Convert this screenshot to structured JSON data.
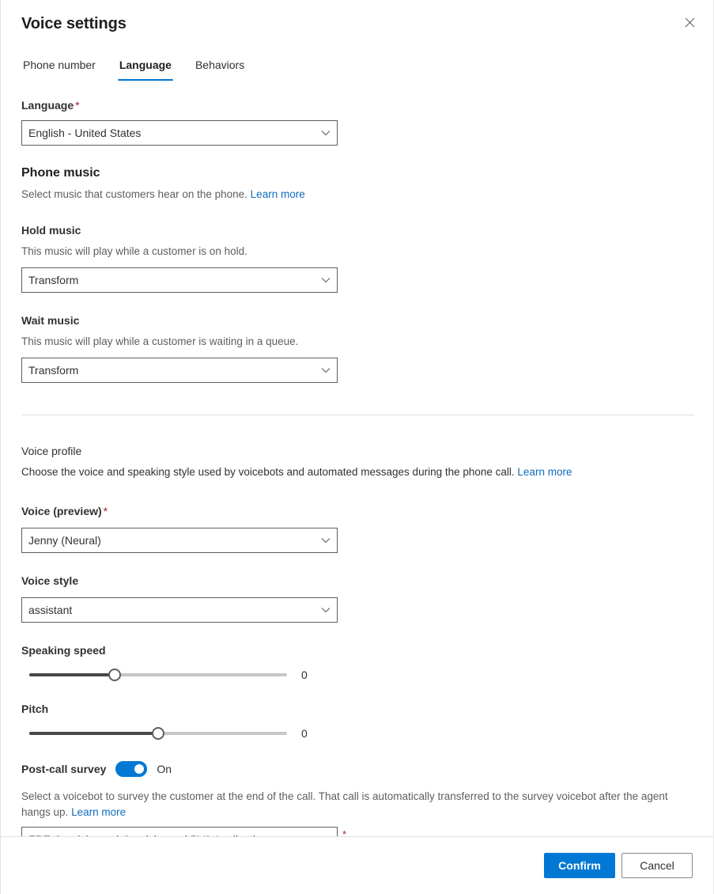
{
  "panel": {
    "title": "Voice settings",
    "close_icon": "close-icon"
  },
  "tabs": [
    {
      "label": "Phone number",
      "active": false
    },
    {
      "label": "Language",
      "active": true
    },
    {
      "label": "Behaviors",
      "active": false
    }
  ],
  "language_section": {
    "label": "Language",
    "required_marker": "*",
    "value": "English - United States",
    "chevron_icon": "chevron-down-icon"
  },
  "phone_music": {
    "heading": "Phone music",
    "description": "Select music that customers hear on the phone.",
    "learn_more": "Learn more",
    "hold": {
      "label": "Hold music",
      "description": "This music will play while a customer is on hold.",
      "value": "Transform"
    },
    "wait": {
      "label": "Wait music",
      "description": "This music will play while a customer is waiting in a queue.",
      "value": "Transform"
    }
  },
  "voice_profile": {
    "heading": "Voice profile",
    "description": "Choose the voice and speaking style used by voicebots and automated messages during the phone call.",
    "learn_more": "Learn more",
    "voice": {
      "label": "Voice (preview)",
      "required_marker": "*",
      "value": "Jenny (Neural)"
    },
    "style": {
      "label": "Voice style",
      "value": "assistant"
    },
    "speaking_speed": {
      "label": "Speaking speed",
      "value": "0",
      "percent": 33
    },
    "pitch": {
      "label": "Pitch",
      "value": "0",
      "percent": 50
    }
  },
  "post_call_survey": {
    "label": "Post-call survey",
    "toggle_state": "On",
    "toggle_on": true,
    "description": "Select a voicebot to survey the customer at the end of the call. That call is automatically transferred to the survey voicebot after the agent hangs up.",
    "learn_more": "Learn more",
    "voicebot": {
      "value": "FRE Omnichannel Omnichannel PVA Application",
      "required_marker": "*"
    }
  },
  "footer": {
    "confirm_label": "Confirm",
    "cancel_label": "Cancel"
  },
  "colors": {
    "accent": "#0078d4",
    "link": "#0f6cbd",
    "required": "#a4262c",
    "text": "#323130",
    "muted": "#605e5c"
  }
}
